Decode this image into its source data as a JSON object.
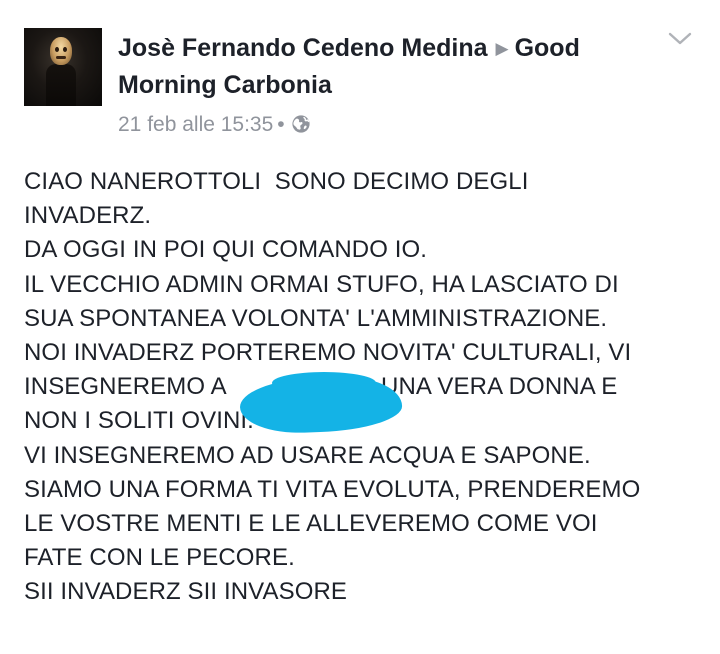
{
  "post": {
    "author": "Josè Fernando Cedeno Medina",
    "group": "Good Morning Carbonia",
    "timestamp": "21 feb alle 15:35",
    "separator": "•",
    "privacy_icon": "globe-icon",
    "menu_icon": "chevron-down-icon",
    "avatar": "profile-avatar"
  },
  "body": {
    "lines": [
      "CIAO NANEROTTOLI  SONO DECIMO DEGLI",
      "INVADERZ.",
      "DA OGGI IN POI QUI COMANDO IO.",
      "IL VECCHIO ADMIN ORMAI STUFO, HA LASCIATO DI",
      "SUA SPONTANEA VOLONTA' L'AMMINISTRAZIONE.",
      "NOI INVADERZ PORTEREMO NOVITA' CULTURALI, VI",
      "INSEGNEREMO A                       UNA VERA DONNA E",
      "NON I SOLITI OVINI.",
      "VI INSEGNEREMO AD USARE ACQUA E SAPONE.",
      "SIAMO UNA FORMA TI VITA EVOLUTA, PRENDEREMO",
      "LE VOSTRE MENTI E LE ALLEVEREMO COME VOI",
      "FATE CON LE PECORE.",
      "SII INVADERZ SII INVASORE"
    ]
  },
  "colors": {
    "text": "#1d2129",
    "meta": "#90949c",
    "redaction": "#14b3e6",
    "background": "#ffffff"
  }
}
